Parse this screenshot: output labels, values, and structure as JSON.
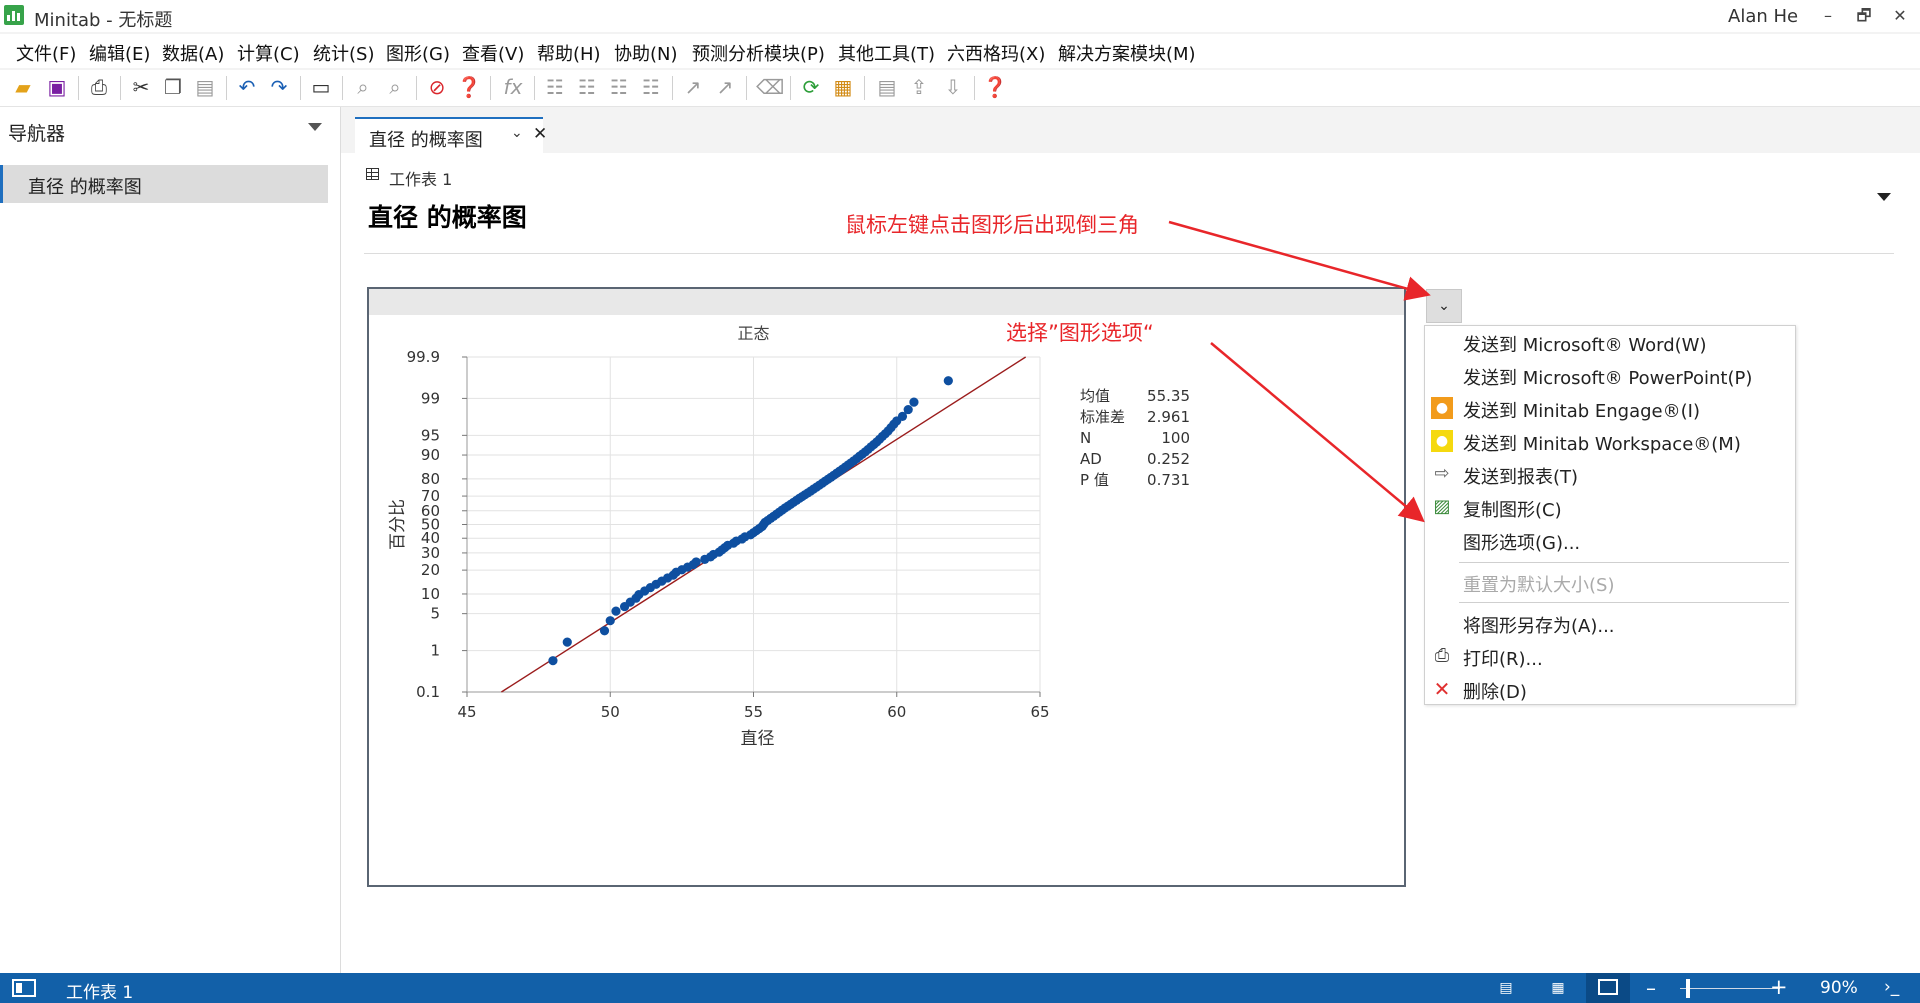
{
  "window": {
    "title": "Minitab - 无标题",
    "user": "Alan He",
    "controls": [
      "–",
      "🗗",
      "✕"
    ]
  },
  "menubar": {
    "items": [
      "文件(F)",
      "编辑(E)",
      "数据(A)",
      "计算(C)",
      "统计(S)",
      "图形(G)",
      "查看(V)",
      "帮助(H)",
      "协助(N)",
      "预测分析模块(P)",
      "其他工具(T)",
      "六西格玛(X)",
      "解决方案模块(M)"
    ]
  },
  "toolbar": {
    "icons": [
      "open-icon",
      "save-icon",
      "print-icon",
      "cut-icon",
      "copy-icon",
      "paste-icon",
      "undo-icon",
      "redo-icon",
      "window-icon",
      "find-icon",
      "replace-icon",
      "cancel-icon",
      "help-icon",
      "formula-icon",
      "layout-icon",
      "layout-icon",
      "layout-icon",
      "layout-icon",
      "brush-icon",
      "brush-icon",
      "eraser-icon",
      "refresh-icon",
      "cube-icon",
      "new-sheet-icon",
      "export-icon",
      "import-icon",
      "help-icon"
    ]
  },
  "navigator": {
    "title": "导航器",
    "items": [
      {
        "label": "直径 的概率图",
        "selected": true
      }
    ]
  },
  "tab": {
    "label": "直径 的概率图",
    "chevron": "⌄",
    "close": "✕"
  },
  "output": {
    "worksheet": "工作表 1",
    "title": "直径 的概率图"
  },
  "annotations": {
    "note1": "鼠标左键点击图形后出现倒三角",
    "note2": "选择”图形选项“",
    "color": "#e8262a"
  },
  "context_menu": {
    "items": [
      {
        "label": "发送到 Microsoft® Word(W)",
        "icon": "",
        "enabled": true
      },
      {
        "label": "发送到 Microsoft® PowerPoint(P)",
        "icon": "",
        "enabled": true
      },
      {
        "label": "发送到 Minitab Engage®(I)",
        "icon": "engage-icon",
        "enabled": true
      },
      {
        "label": "发送到 Minitab Workspace®(M)",
        "icon": "workspace-icon",
        "enabled": true
      },
      {
        "label": "发送到报表(T)",
        "icon": "report-icon",
        "enabled": true
      },
      {
        "label": "复制图形(C)",
        "icon": "copy-graph-icon",
        "enabled": true
      },
      {
        "label": "图形选项(G)...",
        "icon": "",
        "enabled": true
      },
      {
        "label": "重置为默认大小(S)",
        "icon": "",
        "enabled": false
      },
      {
        "label": "将图形另存为(A)...",
        "icon": "",
        "enabled": true
      },
      {
        "label": "打印(R)...",
        "icon": "print-icon",
        "enabled": true
      },
      {
        "label": "删除(D)",
        "icon": "delete-icon",
        "enabled": true
      }
    ]
  },
  "statusbar": {
    "worksheet": "工作表 1",
    "zoom": "90%",
    "zoom_level": 0.9,
    "minus": "–",
    "plus": "+",
    "cmd": "›_"
  },
  "chart_data": {
    "type": "scatter",
    "title": "正态",
    "xlabel": "直径",
    "ylabel": "百分比",
    "xlim": [
      45,
      65
    ],
    "xticks": [
      "45",
      "50",
      "55",
      "60",
      "65"
    ],
    "y_scale": "normal-probability",
    "yticks": [
      "0.1",
      "1",
      "5",
      "10",
      "20",
      "30",
      "40",
      "50",
      "60",
      "70",
      "80",
      "90",
      "95",
      "99",
      "99.9"
    ],
    "grid": true,
    "fit_line": {
      "x": [
        46.2,
        64.5
      ],
      "y": [
        0.1,
        99.9
      ],
      "color": "#9b1c1c"
    },
    "point_color": "#0e4fa0",
    "stats": {
      "labels": [
        "均值",
        "标准差",
        "N",
        "AD",
        "P 值"
      ],
      "values": [
        "55.35",
        "2.961",
        "100",
        "0.252",
        "0.731"
      ]
    },
    "series": [
      {
        "x": [
          48.0,
          48.5,
          49.8,
          50.0,
          50.2,
          50.5,
          50.7,
          50.9,
          51.0,
          51.2,
          51.4,
          51.6,
          51.8,
          52.0,
          52.2,
          52.3,
          52.5,
          52.7,
          52.9,
          53.0,
          53.3,
          53.5,
          53.6,
          53.8,
          53.9,
          54.0,
          54.1,
          54.3,
          54.4,
          54.6,
          54.7,
          54.9,
          55.0,
          55.1,
          55.2,
          55.3,
          55.35,
          55.4,
          55.5,
          55.6,
          55.7,
          55.8,
          55.9,
          56.0,
          56.1,
          56.2,
          56.3,
          56.4,
          56.5,
          56.6,
          56.7,
          56.8,
          56.9,
          57.0,
          57.1,
          57.2,
          57.3,
          57.4,
          57.5,
          57.6,
          57.7,
          57.8,
          57.9,
          58.0,
          58.1,
          58.2,
          58.3,
          58.4,
          58.5,
          58.6,
          58.7,
          58.8,
          58.9,
          59.0,
          59.1,
          59.2,
          59.3,
          59.4,
          59.5,
          59.6,
          59.7,
          59.8,
          59.9,
          60.0,
          60.2,
          60.4,
          60.6,
          61.8
        ],
        "y": [
          0.6,
          1.5,
          2.5,
          3.8,
          5.5,
          6.5,
          7.6,
          8.7,
          9.8,
          11.0,
          12.2,
          13.5,
          14.8,
          16.2,
          17.5,
          18.9,
          20.2,
          21.6,
          23.0,
          24.5,
          26.0,
          27.5,
          29.0,
          30.5,
          32.0,
          33.5,
          35.0,
          36.5,
          38.0,
          39.5,
          41.0,
          42.5,
          44.0,
          45.5,
          47.0,
          48.5,
          50.0,
          51.5,
          53.0,
          54.5,
          56.0,
          57.5,
          59.0,
          60.5,
          62.0,
          63.3,
          64.6,
          65.9,
          67.2,
          68.5,
          69.7,
          70.9,
          72.0,
          73.2,
          74.4,
          75.5,
          76.6,
          77.7,
          78.8,
          79.8,
          80.8,
          81.8,
          82.8,
          83.7,
          84.6,
          85.5,
          86.4,
          87.2,
          88.0,
          88.8,
          89.6,
          90.3,
          91.0,
          91.7,
          92.4,
          93.0,
          93.6,
          94.2,
          94.8,
          95.3,
          95.8,
          96.3,
          96.8,
          97.2,
          97.7,
          98.3,
          98.8,
          99.6
        ]
      }
    ]
  }
}
